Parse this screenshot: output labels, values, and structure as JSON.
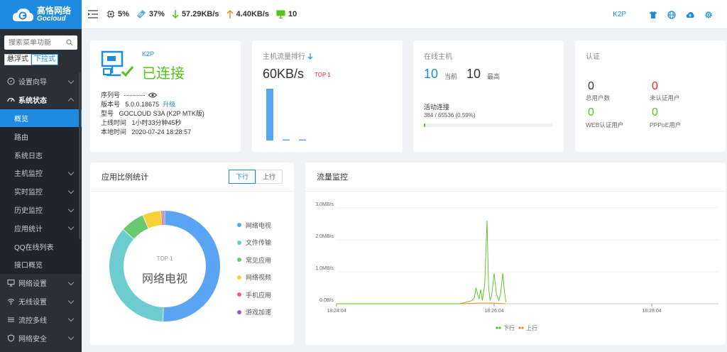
{
  "brand": {
    "cn": "高恪网络",
    "en": "Gocloud"
  },
  "search": {
    "placeholder": "搜索菜单功能"
  },
  "mode": {
    "floating": "悬浮式",
    "dropdown": "下拉式"
  },
  "nav": {
    "setup": "设置向导",
    "system_status": "系统状态",
    "sub_items": [
      "概览",
      "路由",
      "系统日志",
      "主机监控",
      "实时监控",
      "历史监控",
      "应用统计",
      "QQ在线列表",
      "接口概览"
    ],
    "network": "网络设置",
    "wireless": "无线设置",
    "flow_control": "流控多线",
    "security": "网络安全"
  },
  "topbar": {
    "cpu": "5%",
    "memory": "37%",
    "download": "57.29KB/s",
    "upload": "4.40KB/s",
    "hosts": "10",
    "model": "K2P"
  },
  "device": {
    "model_tag": "K2P",
    "status": "已连接",
    "serial_label": "序列号",
    "serial_value": "···············",
    "version_label": "版本号",
    "version_value": "5.0.0.18675",
    "upgrade": "升级",
    "type_label": "型号",
    "type_value": "GOCLOUD S3A (K2P MTK版)",
    "uptime_label": "上线时间",
    "uptime_value": "1小时33分钟45秒",
    "localtime_label": "本地时间",
    "localtime_value": "2020-07-24 18:28:57"
  },
  "traffic_rank": {
    "title": "主机流量排行",
    "value": "60KB/s",
    "badge": "TOP 1",
    "bars": [
      1.0,
      0.02,
      0.02
    ]
  },
  "online_hosts": {
    "title": "在线主机",
    "current": "10",
    "current_label": "当前",
    "max": "10",
    "max_label": "最高",
    "conn_label": "活动连接",
    "conn_value": "384 / 65536 (0.59%)",
    "conn_percent": 0.59
  },
  "auth": {
    "title": "认证",
    "total": "0",
    "total_label": "总用户数",
    "unauth": "0",
    "unauth_label": "未认证用户",
    "web": "0",
    "web_label": "WEB认证用户",
    "pppoe": "0",
    "pppoe_label": "PPPoE用户"
  },
  "app_stats": {
    "title": "应用比例统计",
    "tab_down": "下行",
    "tab_up": "上行",
    "center_top": "TOP 1",
    "center_label": "网络电视",
    "legend": [
      {
        "name": "网络电视",
        "color": "#5aa4f4"
      },
      {
        "name": "文件传输",
        "color": "#6cccd0"
      },
      {
        "name": "常见应用",
        "color": "#69c96e"
      },
      {
        "name": "网络视频",
        "color": "#f7d138"
      },
      {
        "name": "手机应用",
        "color": "#ef5f7c"
      },
      {
        "name": "游戏加速",
        "color": "#8a5fd8"
      }
    ]
  },
  "chart_data": [
    {
      "type": "pie",
      "title": "应用比例统计",
      "categories": [
        "网络电视",
        "文件传输",
        "常见应用",
        "网络视频",
        "手机应用",
        "游戏加速"
      ],
      "values": [
        50.5,
        36,
        7,
        5.4,
        0.6,
        0.5
      ]
    },
    {
      "type": "line",
      "title": "流量监控",
      "x": [
        "18:24:04",
        "18:26:04",
        "18:28:04"
      ],
      "y_ticks": [
        "0.0B/s",
        "1.0MB/s",
        "2.0MB/s",
        "3.0MB/s"
      ],
      "ylim": [
        0,
        3.0
      ],
      "series": [
        {
          "name": "下行",
          "color": "#52c41a",
          "points": [
            [
              0,
              0.0
            ],
            [
              0.78,
              0.0
            ],
            [
              0.8,
              0.02
            ],
            [
              0.83,
              0.06
            ],
            [
              0.86,
              0.1
            ],
            [
              0.875,
              0.2
            ],
            [
              0.885,
              0.5
            ],
            [
              0.895,
              0.3
            ],
            [
              0.905,
              0.15
            ],
            [
              0.915,
              0.45
            ],
            [
              0.925,
              0.1
            ],
            [
              0.94,
              0.6
            ],
            [
              0.955,
              2.6
            ],
            [
              0.965,
              0.5
            ],
            [
              0.975,
              0.1
            ],
            [
              0.985,
              0.3
            ],
            [
              1.0,
              0.95
            ],
            [
              1.015,
              0.3
            ],
            [
              1.03,
              0.1
            ],
            [
              1.04,
              0.3
            ],
            [
              1.055,
              0.95
            ],
            [
              1.065,
              0.4
            ],
            [
              1.075,
              0.05
            ]
          ]
        },
        {
          "name": "上行",
          "color": "#fa8c16",
          "points": [
            [
              0,
              0.0
            ],
            [
              0.78,
              0.0
            ],
            [
              0.9,
              0.02
            ],
            [
              1.0,
              0.02
            ],
            [
              1.075,
              0.0
            ]
          ]
        }
      ]
    }
  ]
}
